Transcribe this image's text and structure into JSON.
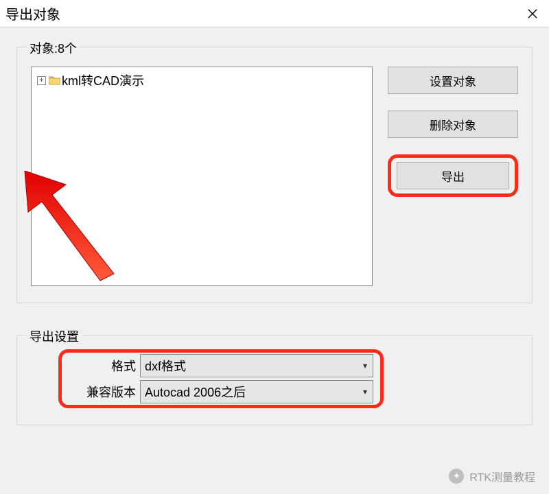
{
  "window": {
    "title": "导出对象"
  },
  "objects_group": {
    "label": "对象:8个",
    "tree": {
      "items": [
        {
          "label": "kml转CAD演示"
        }
      ]
    },
    "buttons": {
      "set_object": "设置对象",
      "delete_object": "删除对象",
      "export": "导出"
    }
  },
  "settings_group": {
    "label": "导出设置",
    "format_label": "格式",
    "format_value": "dxf格式",
    "version_label": "兼容版本",
    "version_value": "Autocad 2006之后"
  },
  "watermark": {
    "text": "RTK测量教程"
  }
}
